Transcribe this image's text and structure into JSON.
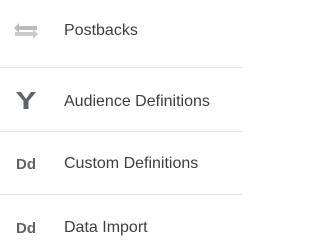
{
  "nav": {
    "items": [
      {
        "label": "Postbacks",
        "icon": "postbacks-icon"
      },
      {
        "label": "Audience Definitions",
        "icon": "audience-definitions-icon"
      },
      {
        "label": "Custom Definitions",
        "icon": "custom-definitions-icon",
        "icon_text": "Dd"
      },
      {
        "label": "Data Import",
        "icon": "data-import-icon",
        "icon_text": "Dd"
      }
    ]
  },
  "colors": {
    "text": "#3c4043",
    "icon_dark": "#5f6368",
    "icon_light": "#b8bcbf",
    "divider": "#e6e6e6"
  }
}
